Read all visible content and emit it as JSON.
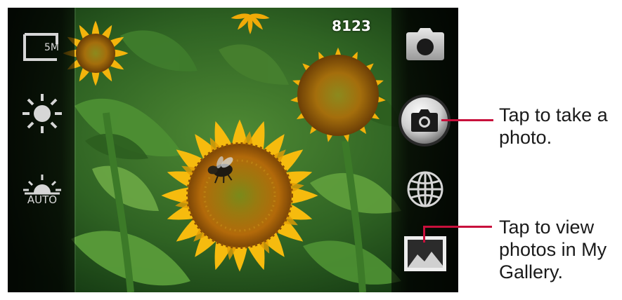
{
  "camera": {
    "photo_counter": "8123",
    "resolution_label": "5M",
    "scene_mode_label": "AUTO"
  },
  "left_controls": [
    {
      "name": "resolution-icon"
    },
    {
      "name": "brightness-icon"
    },
    {
      "name": "scene-mode-auto-icon"
    }
  ],
  "right_controls": [
    {
      "name": "camera-mode-icon"
    },
    {
      "name": "shutter-button"
    },
    {
      "name": "globe-icon"
    },
    {
      "name": "gallery-thumbnail"
    }
  ],
  "callouts": {
    "shutter": {
      "line1": "Tap to take a",
      "line2": "photo."
    },
    "gallery": {
      "line1": "Tap to view",
      "line2": "photos in My",
      "line3": "Gallery."
    }
  },
  "colors": {
    "callout_line": "#c8103c",
    "sunflower_petal": "#f5b800",
    "foliage": "#3d7a2a"
  }
}
